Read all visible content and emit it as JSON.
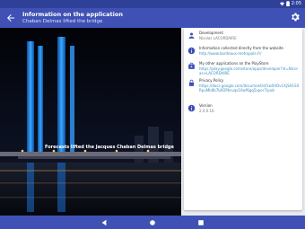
{
  "status_bar": {
    "time": "2:05"
  },
  "app_bar": {
    "title": "Information on the application",
    "subtitle": "Chaban Delmas lifted the bridge"
  },
  "photo": {
    "caption": "Forecasts lifted the Jacques Chaban Delmas bridge"
  },
  "info": {
    "development": {
      "label": "Development",
      "value": "Nicolas LACORDAIRE"
    },
    "collected": {
      "label": "Information collected directly from the website",
      "value": "http://www.bordeaux-metropole.fr/"
    },
    "other_apps": {
      "label": "My other applications on the PlayStore",
      "value": "https://play.google.com/store/apps/developer?id=Nicolas+LACORDAIRE"
    },
    "privacy": {
      "label": "Privacy Policy",
      "value": "https://docs.google.com/document/d/1w0VDv1XjSH1S0RpuMk8b7b0DPbruqx10wf6gq5xpor7/pub"
    },
    "version": {
      "label": "Version",
      "value": "2.0.0.16"
    }
  },
  "colors": {
    "primary": "#3f51b5",
    "primary_dark": "#2f4099",
    "link": "#3b8fbf",
    "panel_icon": "#3f51b5"
  }
}
